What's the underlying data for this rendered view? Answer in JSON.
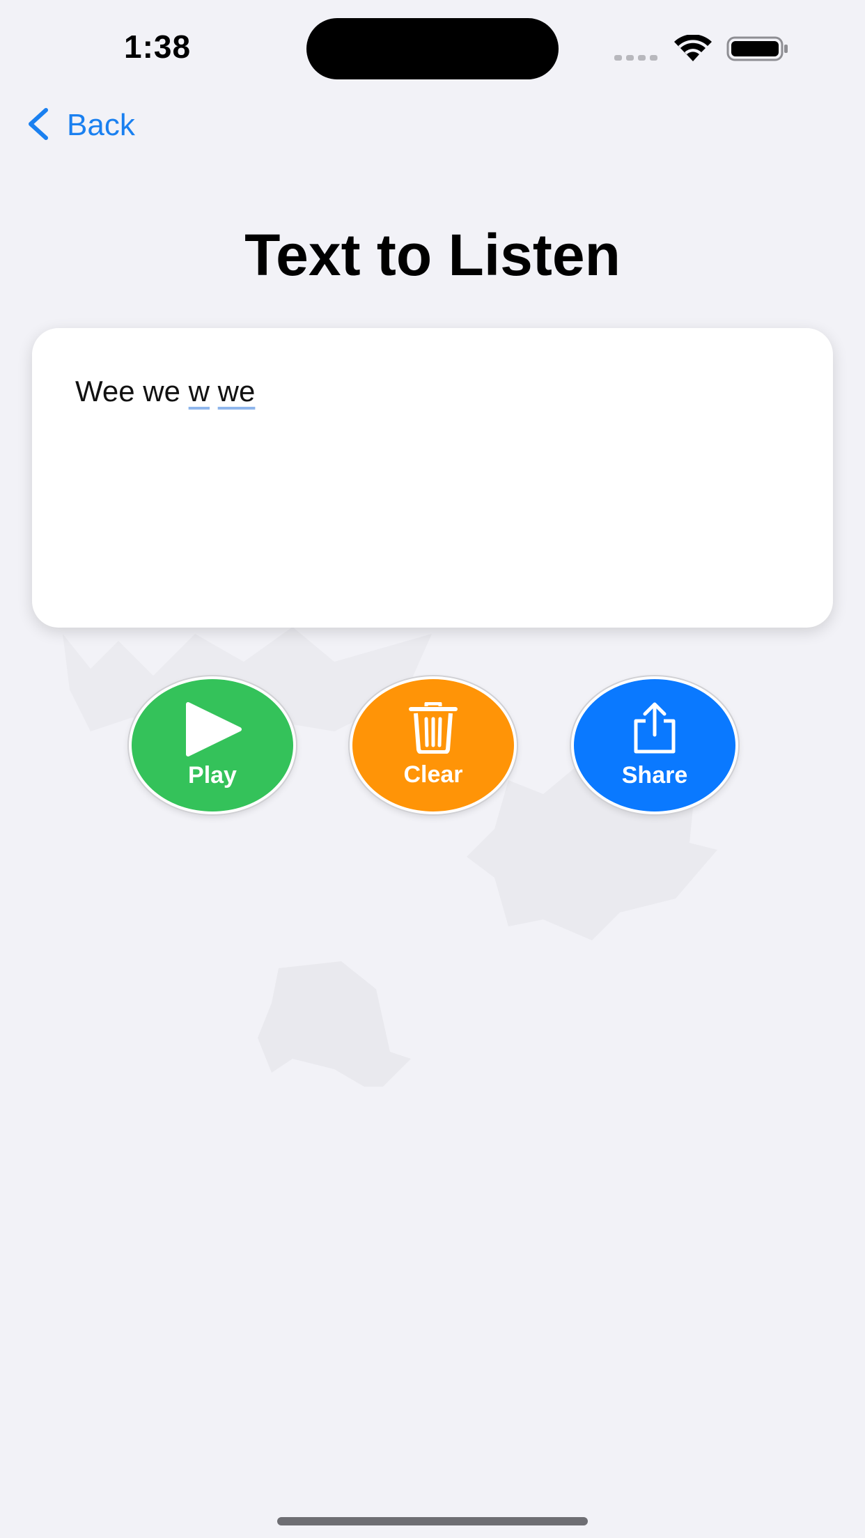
{
  "status_bar": {
    "time": "1:38"
  },
  "nav": {
    "back_label": "Back"
  },
  "page": {
    "title": "Text to Listen"
  },
  "editor": {
    "words": [
      "Wee",
      "we",
      "w",
      "we"
    ]
  },
  "actions": {
    "play_label": "Play",
    "clear_label": "Clear",
    "share_label": "Share"
  },
  "colors": {
    "background": "#f2f2f7",
    "accent": "#1a80f0",
    "play": "#34c25a",
    "clear": "#ff9407",
    "share": "#0a79ff"
  }
}
